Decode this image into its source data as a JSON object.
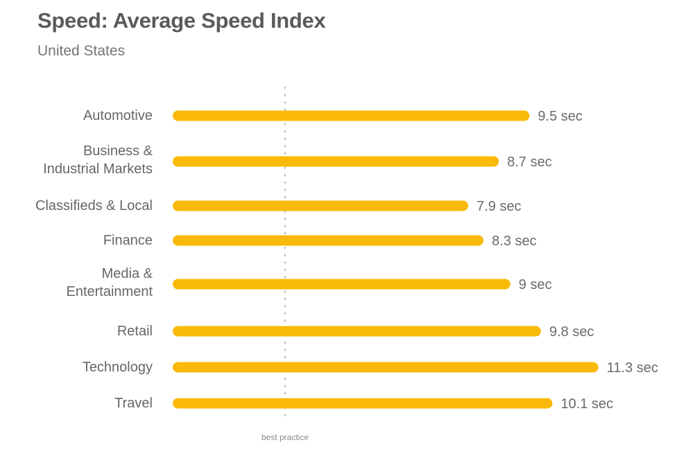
{
  "chart_data": {
    "type": "bar",
    "orientation": "horizontal",
    "title": "Speed: Average Speed Index",
    "subtitle": "United States",
    "xlabel": "",
    "ylabel": "",
    "unit": "sec",
    "grid": false,
    "legend": "none",
    "categories": [
      [
        "Automotive"
      ],
      [
        "Business &",
        "Industrial Markets"
      ],
      [
        "Classifieds & Local"
      ],
      [
        "Finance"
      ],
      [
        "Media &",
        "Entertainment"
      ],
      [
        "Retail"
      ],
      [
        "Technology"
      ],
      [
        "Travel"
      ]
    ],
    "values": [
      9.5,
      8.7,
      7.9,
      8.3,
      9.0,
      9.8,
      11.3,
      10.1
    ],
    "value_labels": [
      "9.5 sec",
      "8.7 sec",
      "7.9 sec",
      "8.3 sec",
      "9 sec",
      "9.8 sec",
      "11.3 sec",
      "10.1 sec"
    ],
    "reference_line": {
      "label": "best practice",
      "value": 3.3
    },
    "bar_color": "#F9B908",
    "xlim": [
      0,
      11.3
    ]
  }
}
